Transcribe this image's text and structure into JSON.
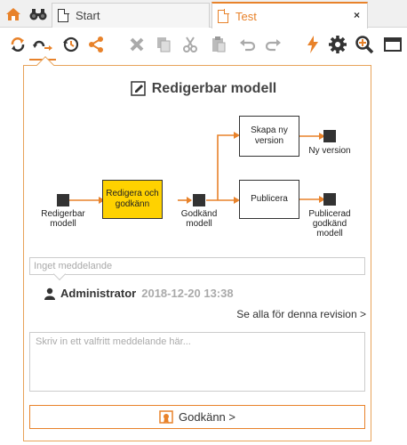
{
  "tabs": {
    "start_label": "Start",
    "test_label": "Test",
    "close_symbol": "×"
  },
  "toolbar": {
    "icons": [
      "refresh-icon",
      "approve-flow-icon",
      "history-icon",
      "share-icon",
      "delete-icon",
      "copy-icon",
      "cut-icon",
      "paste-icon",
      "undo-icon",
      "redo-icon",
      "flash-icon",
      "gear-icon",
      "zoom-icon",
      "window-icon"
    ]
  },
  "panel": {
    "title": "Redigerbar modell"
  },
  "diagram": {
    "state_editable": "Redigerbar\nmodell",
    "box_edit_approve": "Redigera och\ngodkänn",
    "state_approved": "Godkänd\nmodell",
    "box_create_version": "Skapa ny\nversion",
    "state_new_version": "Ny version",
    "box_publish": "Publicera",
    "state_published": "Publicerad\ngodkänd\nmodell"
  },
  "messages": {
    "last_message": "Inget meddelande",
    "author": "Administrator",
    "date": "2018-12-20 13:38",
    "see_all": "Se alla för denna revision >",
    "comment_placeholder": "Skriv in ett valfritt meddelande här...",
    "approve_label": "Godkänn >"
  },
  "colors": {
    "accent": "#e8822a",
    "active_box": "#ffd200",
    "dark": "#333333"
  }
}
